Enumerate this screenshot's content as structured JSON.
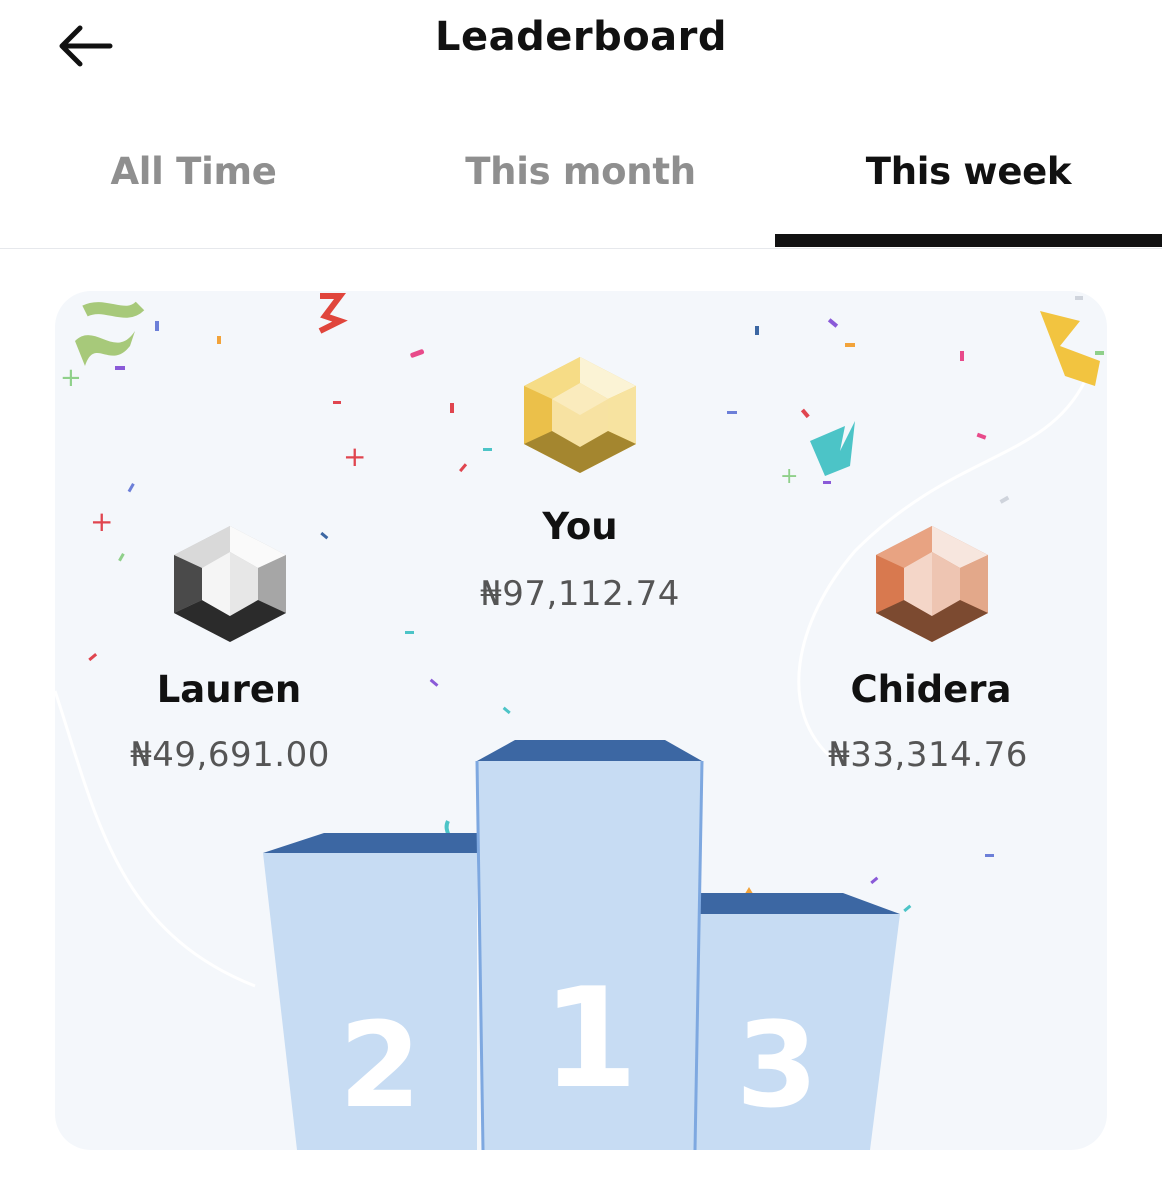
{
  "header": {
    "title": "Leaderboard",
    "back_icon": "arrow-left-icon"
  },
  "tabs": [
    {
      "label": "All Time",
      "active": false
    },
    {
      "label": "This month",
      "active": false
    },
    {
      "label": "This week",
      "active": true
    }
  ],
  "podium": {
    "first": {
      "rank": "1",
      "name": "You",
      "amount": "₦97,112.74",
      "medal": "gold-gem-icon"
    },
    "second": {
      "rank": "2",
      "name": "Lauren",
      "amount": "₦49,691.00",
      "medal": "silver-gem-icon"
    },
    "third": {
      "rank": "3",
      "name": "Chidera",
      "amount": "₦33,314.76",
      "medal": "bronze-gem-icon"
    }
  },
  "colors": {
    "active_tab": "#111111",
    "inactive_tab": "#8f8f8f",
    "card_bg": "#f4f7fb",
    "podium_face": "#c7dcf3",
    "podium_top": "#3c67a3",
    "gold": "#f0c95a",
    "silver": "#bdbdbd",
    "bronze": "#d98a62"
  }
}
